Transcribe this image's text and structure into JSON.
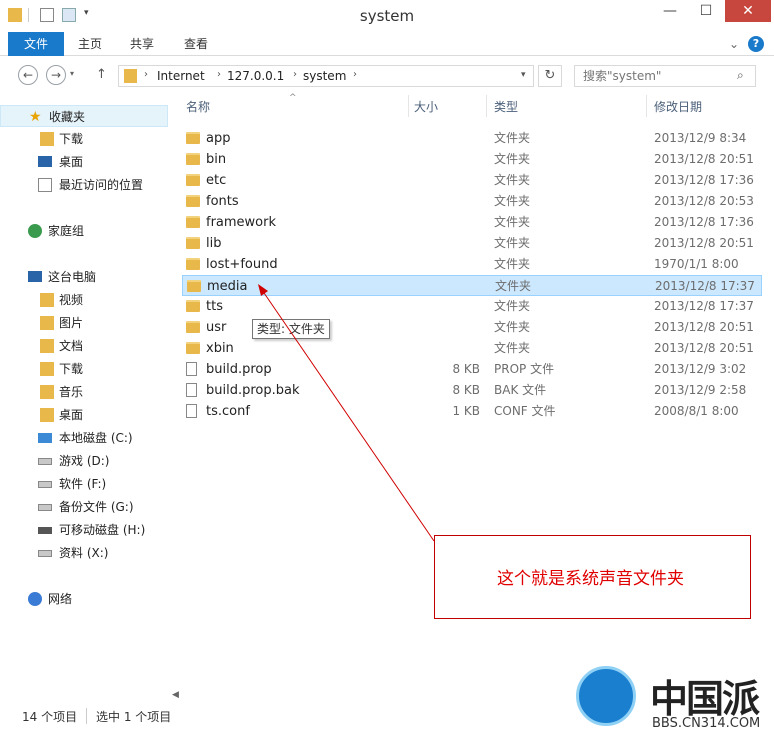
{
  "window": {
    "title": "system",
    "minimize": "—",
    "maximize": "☐",
    "close": "✕"
  },
  "ribbon": {
    "tabs": [
      "文件",
      "主页",
      "共享",
      "查看"
    ],
    "expand": "⌄",
    "help": "?"
  },
  "address": {
    "back": "←",
    "forward": "→",
    "up": "↑",
    "crumbs": [
      "Internet",
      "127.0.0.1",
      "system"
    ],
    "refresh": "↻",
    "search_placeholder": "搜索\"system\""
  },
  "sidebar": {
    "favorites": {
      "label": "收藏夹",
      "items": [
        "下载",
        "桌面",
        "最近访问的位置"
      ]
    },
    "homegroup": "家庭组",
    "pc": {
      "label": "这台电脑",
      "items": [
        "视频",
        "图片",
        "文档",
        "下载",
        "音乐",
        "桌面",
        "本地磁盘 (C:)",
        "游戏 (D:)",
        "软件 (F:)",
        "备份文件 (G:)",
        "可移动磁盘 (H:)",
        "资料 (X:)"
      ]
    },
    "network": "网络"
  },
  "columns": {
    "name": "名称",
    "size": "大小",
    "type": "类型",
    "date": "修改日期"
  },
  "files": [
    {
      "name": "app",
      "size": "",
      "type": "文件夹",
      "date": "2013/12/9 8:34",
      "kind": "folder"
    },
    {
      "name": "bin",
      "size": "",
      "type": "文件夹",
      "date": "2013/12/8 20:51",
      "kind": "folder"
    },
    {
      "name": "etc",
      "size": "",
      "type": "文件夹",
      "date": "2013/12/8 17:36",
      "kind": "folder"
    },
    {
      "name": "fonts",
      "size": "",
      "type": "文件夹",
      "date": "2013/12/8 20:53",
      "kind": "folder"
    },
    {
      "name": "framework",
      "size": "",
      "type": "文件夹",
      "date": "2013/12/8 17:36",
      "kind": "folder"
    },
    {
      "name": "lib",
      "size": "",
      "type": "文件夹",
      "date": "2013/12/8 20:51",
      "kind": "folder"
    },
    {
      "name": "lost+found",
      "size": "",
      "type": "文件夹",
      "date": "1970/1/1 8:00",
      "kind": "folder"
    },
    {
      "name": "media",
      "size": "",
      "type": "文件夹",
      "date": "2013/12/8 17:37",
      "kind": "folder",
      "selected": true
    },
    {
      "name": "tts",
      "size": "",
      "type": "文件夹",
      "date": "2013/12/8 17:37",
      "kind": "folder"
    },
    {
      "name": "usr",
      "size": "",
      "type": "文件夹",
      "date": "2013/12/8 20:51",
      "kind": "folder"
    },
    {
      "name": "xbin",
      "size": "",
      "type": "文件夹",
      "date": "2013/12/8 20:51",
      "kind": "folder"
    },
    {
      "name": "build.prop",
      "size": "8 KB",
      "type": "PROP 文件",
      "date": "2013/12/9 3:02",
      "kind": "file"
    },
    {
      "name": "build.prop.bak",
      "size": "8 KB",
      "type": "BAK 文件",
      "date": "2013/12/9 2:58",
      "kind": "file"
    },
    {
      "name": "ts.conf",
      "size": "1 KB",
      "type": "CONF 文件",
      "date": "2008/8/1 8:00",
      "kind": "file"
    }
  ],
  "tooltip": "类型: 文件夹",
  "annotation": "这个就是系统声音文件夹",
  "status": {
    "count": "14 个项目",
    "selected": "选中 1 个项目"
  },
  "watermark": {
    "brand": "中国派",
    "site": "BBS.CN314.COM"
  },
  "colors": {
    "accent": "#1979ca",
    "selection": "#cce8ff",
    "annotation": "#e00000",
    "folder": "#e8b84a"
  }
}
